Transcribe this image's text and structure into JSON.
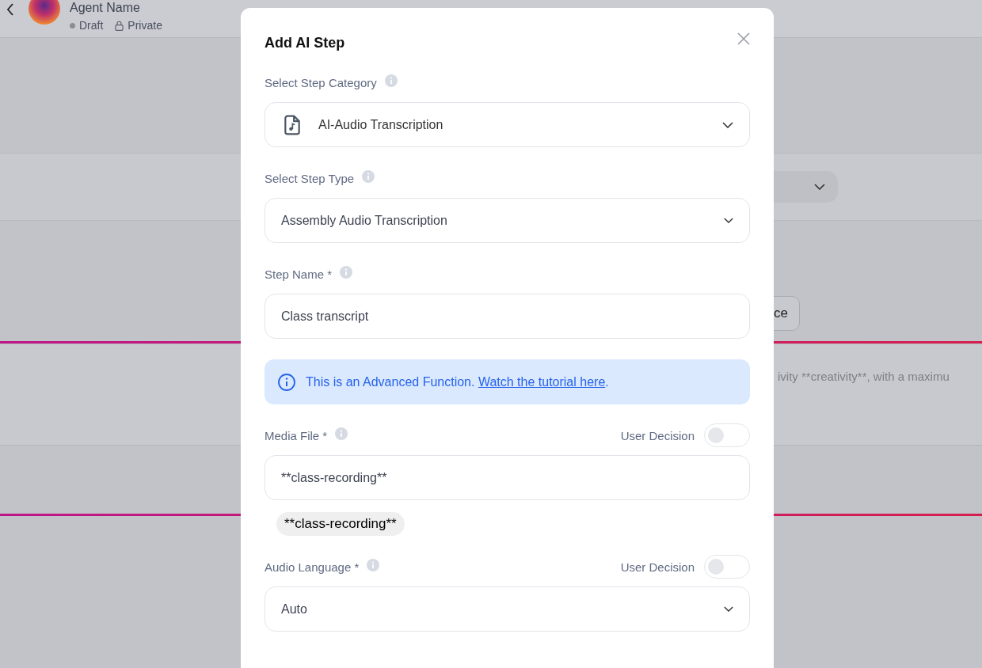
{
  "header": {
    "title": "Agent Name",
    "status": "Draft",
    "visibility": "Private"
  },
  "background": {
    "button_label": "ce",
    "description": "ivity **creativity**, with a maximu"
  },
  "modal": {
    "title": "Add AI Step",
    "fields": [
      {
        "kind": "category",
        "label": "Select Step Category",
        "value": "AI-Audio Transcription"
      },
      {
        "kind": "select",
        "label": "Select Step Type",
        "value": "Assembly Audio Transcription"
      },
      {
        "kind": "text",
        "label": "Step Name *",
        "value": "Class transcript"
      },
      {
        "kind": "notice",
        "text": "This is an Advanced Function.",
        "link": "Watch the tutorial here",
        "end": "."
      },
      {
        "kind": "text",
        "label": "Media File *",
        "user_decision": {
          "label": "User Decision",
          "on": false
        },
        "value": "**class-recording**",
        "chips": [
          "**class-recording**"
        ]
      },
      {
        "kind": "select",
        "label": "Audio Language *",
        "user_decision": {
          "label": "User Decision",
          "on": false
        },
        "value": "Auto"
      }
    ]
  }
}
